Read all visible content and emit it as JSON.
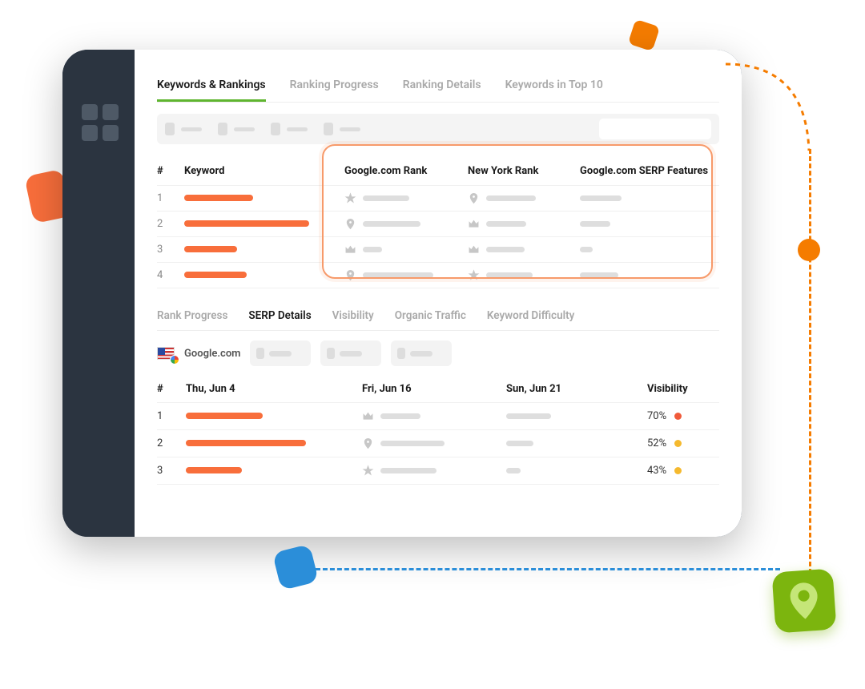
{
  "primary_tabs": {
    "t0": "Keywords & Rankings",
    "t1": "Ranking Progress",
    "t2": "Ranking Details",
    "t3": "Keywords in Top 10"
  },
  "keyword_table": {
    "head_num": "#",
    "head_keyword": "Keyword",
    "head_col1": "Google.com Rank",
    "head_col2": "New York Rank",
    "head_col3": "Google.com SERP Features",
    "rows": {
      "r0": {
        "idx": "1"
      },
      "r1": {
        "idx": "2"
      },
      "r2": {
        "idx": "3"
      },
      "r3": {
        "idx": "4"
      }
    }
  },
  "secondary_tabs": {
    "s0": "Rank Progress",
    "s1": "SERP Details",
    "s2": "Visibility",
    "s3": "Organic Traffic",
    "s4": "Keyword Difficulty"
  },
  "source": {
    "label": "Google.com"
  },
  "date_table": {
    "head_num": "#",
    "head_d1": "Thu, Jun 4",
    "head_d2": "Fri, Jun 16",
    "head_d3": "Sun, Jun 21",
    "head_vis": "Visibility",
    "rows": {
      "r0": {
        "idx": "1",
        "vis": "70%",
        "dot": "#f05a3a"
      },
      "r1": {
        "idx": "2",
        "vis": "52%",
        "dot": "#f5b92e"
      },
      "r2": {
        "idx": "3",
        "vis": "43%",
        "dot": "#f5b92e"
      }
    }
  }
}
